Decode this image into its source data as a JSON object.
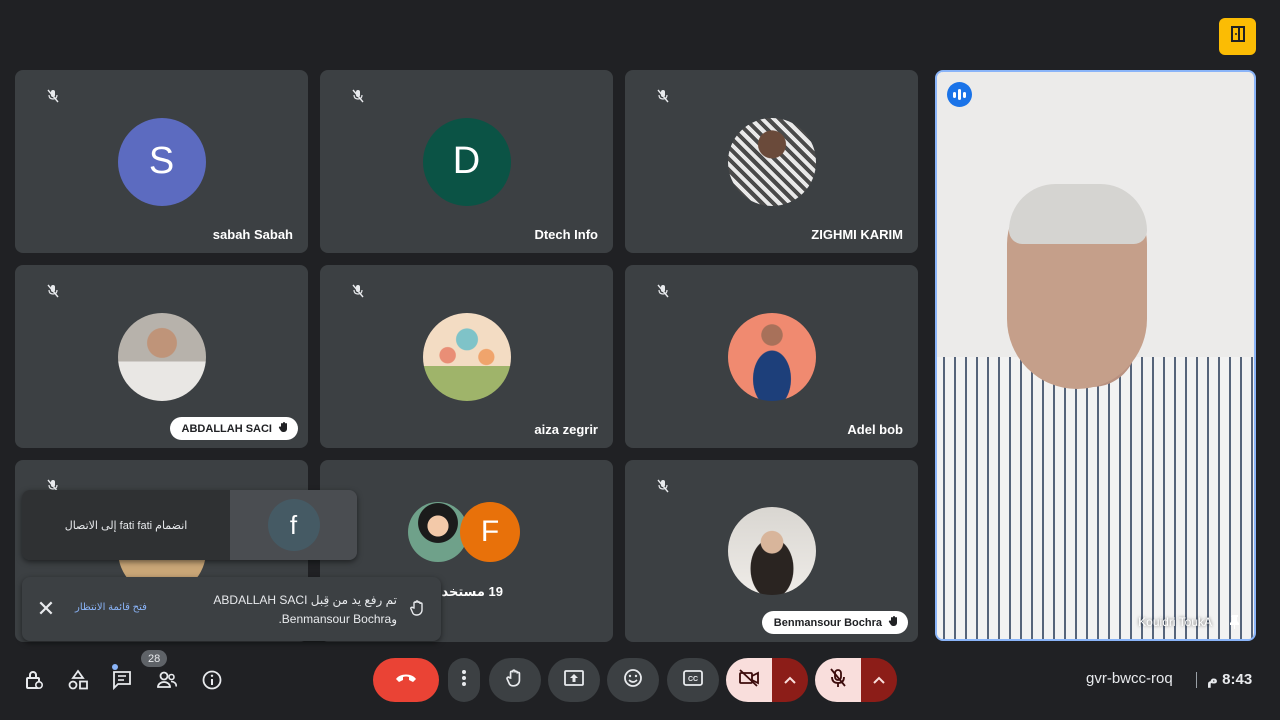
{
  "tiles": [
    {
      "name": "sabah Sabah",
      "initial": "S",
      "avatar_color": "#5c6bc0"
    },
    {
      "name": "Dtech Info",
      "initial": "D",
      "avatar_color": "#0b5345"
    },
    {
      "name": "ZIGHMI KARIM",
      "avatar": "photo"
    },
    {
      "name": "ABDALLAH SACI",
      "avatar": "photo",
      "hand_raised": true
    },
    {
      "name": "aiza zegrir",
      "avatar": "photo"
    },
    {
      "name": "Adel bob",
      "avatar": "photo"
    },
    {
      "name": "",
      "avatar": "photo"
    },
    {
      "name": "19 مستخدمًا آخر",
      "stacked": [
        "photo",
        "F"
      ],
      "stacked_color": "#e8710a"
    },
    {
      "name": "Benmansour Bochra",
      "avatar": "photo",
      "hand_raised": true
    }
  ],
  "speaker": {
    "name": "Kouidri ToukA"
  },
  "toasts": {
    "join": {
      "text": "انضمام fati fati إلى الاتصال",
      "initial": "f"
    },
    "hand": {
      "message": "تم رفع يد من قِبل ABDALLAH SACI و‎Benmansour Bochra.",
      "link": "فتح قائمة الانتظار"
    }
  },
  "bottom": {
    "people_count": "28",
    "meeting_code": "gvr-bwcc-roq",
    "time": "8:43 م"
  },
  "colors": {
    "background": "#202124",
    "tile": "#3c4043",
    "leave": "#ea4335",
    "active_border": "#8ab4f8",
    "badge": "#fbbc04"
  }
}
